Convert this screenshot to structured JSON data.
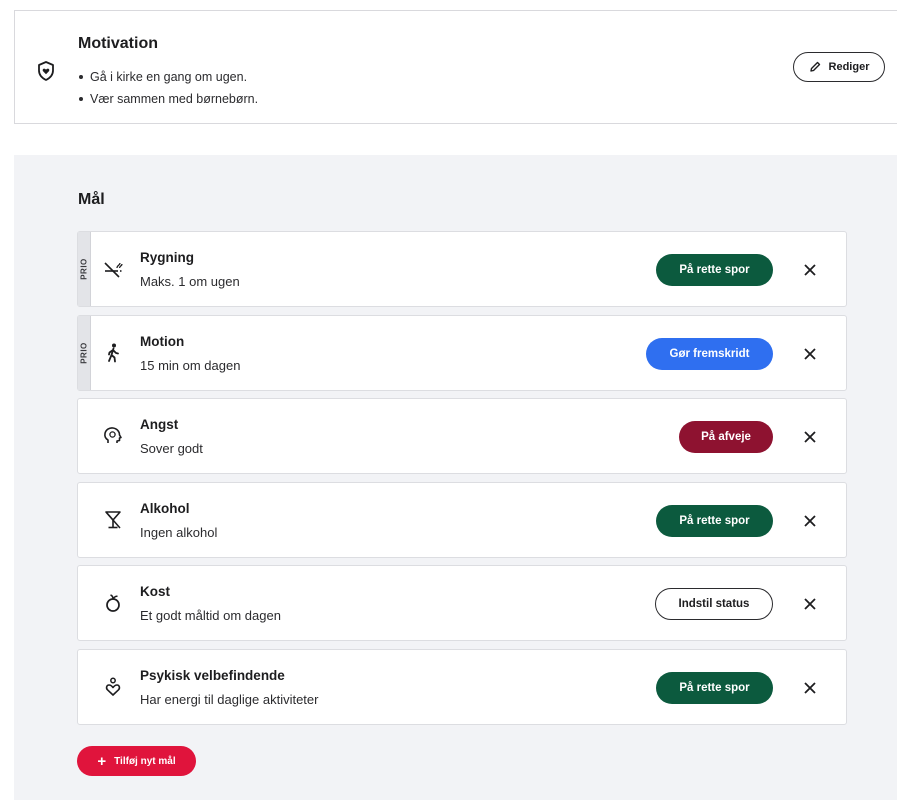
{
  "motivation": {
    "title": "Motivation",
    "icon": "shield-heart-icon",
    "items": [
      "Gå i kirke en gang om ugen.",
      "Vær sammen med børnebørn."
    ],
    "edit_label": "Rediger"
  },
  "goals": {
    "title": "Mål",
    "prio_label": "PRIO",
    "items": [
      {
        "name": "Rygning",
        "subtitle": "Maks. 1 om ugen",
        "status": "På rette spor",
        "status_kind": "green",
        "prio": true,
        "icon": "no-smoking-icon"
      },
      {
        "name": "Motion",
        "subtitle": "15 min om dagen",
        "status": "Gør fremskridt",
        "status_kind": "blue",
        "prio": true,
        "icon": "walking-icon"
      },
      {
        "name": "Angst",
        "subtitle": "Sover godt",
        "status": "På afveje",
        "status_kind": "red",
        "prio": false,
        "icon": "head-icon"
      },
      {
        "name": "Alkohol",
        "subtitle": "Ingen alkohol",
        "status": "På rette spor",
        "status_kind": "green",
        "prio": false,
        "icon": "no-alcohol-icon"
      },
      {
        "name": "Kost",
        "subtitle": "Et godt måltid om dagen",
        "status": "Indstil status",
        "status_kind": "outline",
        "prio": false,
        "icon": "apple-icon"
      },
      {
        "name": "Psykisk velbefindende",
        "subtitle": "Har energi til daglige aktiviteter",
        "status": "På rette spor",
        "status_kind": "green",
        "prio": false,
        "icon": "person-heart-icon"
      }
    ],
    "add_label": "Tilføj nyt mål"
  },
  "colors": {
    "green": "#0c5a3e",
    "blue": "#2f6ff0",
    "red": "#8e1230",
    "add_button": "#e0143c",
    "panel_bg": "#f2f3f6"
  }
}
